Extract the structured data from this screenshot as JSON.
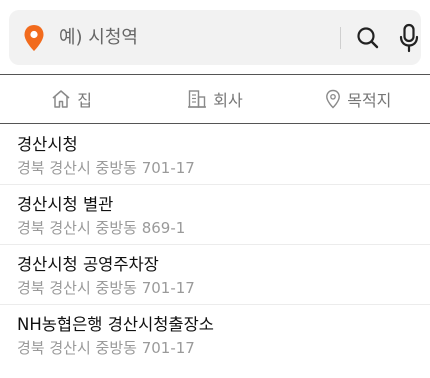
{
  "search": {
    "placeholder": "예) 시청역",
    "value": ""
  },
  "quick_tabs": [
    {
      "label": "집",
      "icon": "home-icon"
    },
    {
      "label": "회사",
      "icon": "building-icon"
    },
    {
      "label": "목적지",
      "icon": "location-pin-icon"
    }
  ],
  "results": [
    {
      "name": "경산시청",
      "address": "경북 경산시 중방동 701-17"
    },
    {
      "name": "경산시청 별관",
      "address": "경북 경산시 중방동 869-1"
    },
    {
      "name": "경산시청 공영주차장",
      "address": "경북 경산시 중방동 701-17"
    },
    {
      "name": "NH농협은행 경산시청출장소",
      "address": "경북 경산시 중방동 701-17"
    }
  ],
  "colors": {
    "accent": "#f26b1d",
    "background": "#ffffff",
    "search_bg": "#f2f2f2"
  }
}
